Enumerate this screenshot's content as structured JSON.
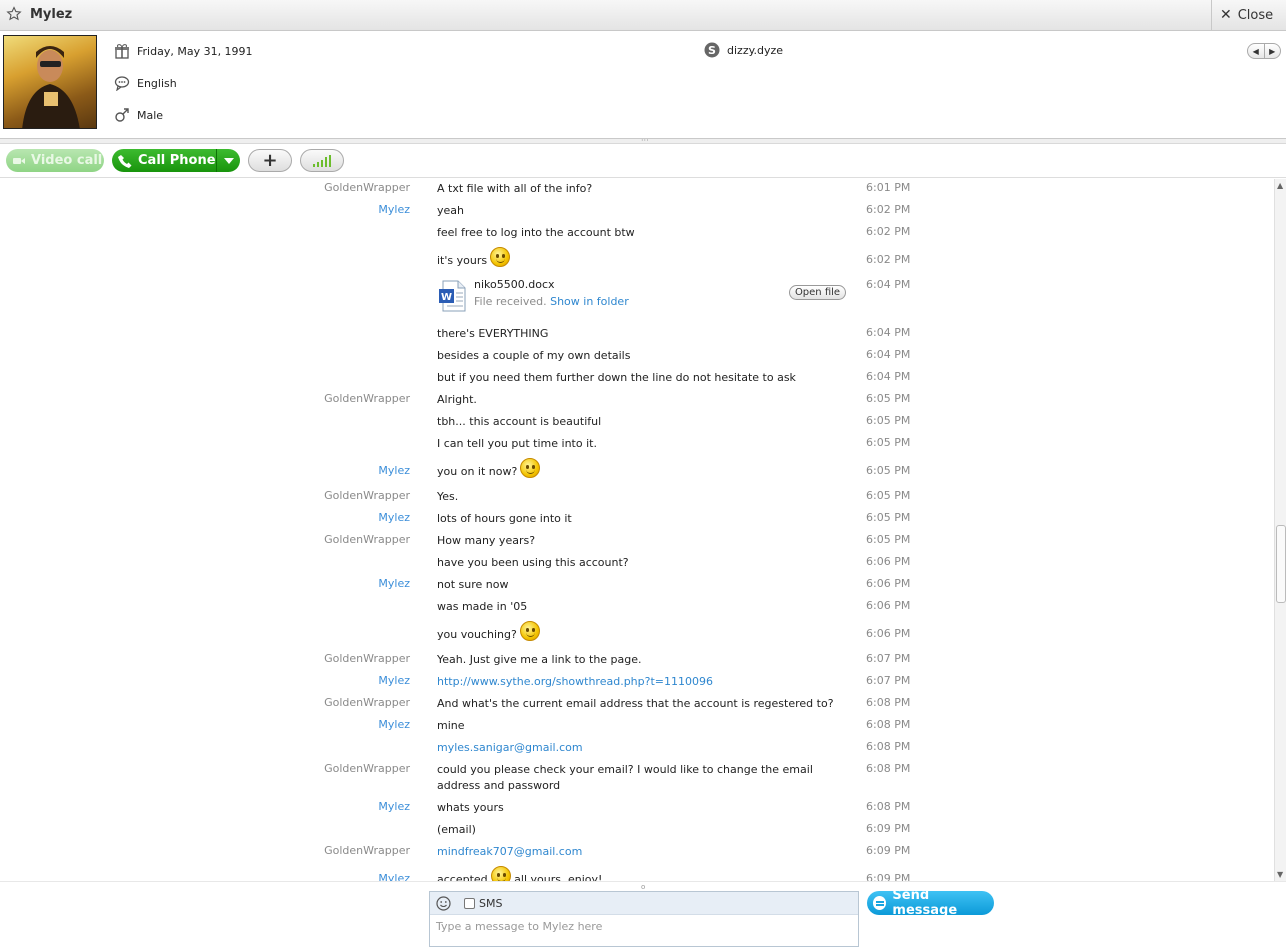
{
  "window": {
    "title": "Mylez",
    "close_label": "Close"
  },
  "profile": {
    "birthday": "Friday, May 31, 1991",
    "language": "English",
    "gender": "Male",
    "skype_name": "dizzy.dyze"
  },
  "toolbar": {
    "video_call": "Video call",
    "call_phone": "Call Phone",
    "add": "+"
  },
  "messages": [
    {
      "sender": "GoldenWrapper",
      "me": false,
      "text": "A txt file with all of the info?",
      "time": "6:01 PM"
    },
    {
      "sender": "Mylez",
      "me": true,
      "text": "yeah",
      "time": "6:02 PM"
    },
    {
      "sender": "",
      "me": true,
      "text": "feel free to log into the account btw",
      "time": "6:02 PM"
    },
    {
      "sender": "",
      "me": true,
      "text": "it's yours",
      "smiley": true,
      "time": "6:02 PM"
    },
    {
      "type": "file",
      "filename": "niko5500.docx",
      "status": "File received.",
      "show_link": "Show in folder",
      "open_label": "Open file",
      "time": "6:04 PM"
    },
    {
      "sender": "",
      "me": true,
      "text": "there's EVERYTHING",
      "time": "6:04 PM"
    },
    {
      "sender": "",
      "me": true,
      "text": "besides a couple of my own details",
      "time": "6:04 PM"
    },
    {
      "sender": "",
      "me": true,
      "text": "but if you need them further down the line do not hesitate to ask",
      "time": "6:04 PM"
    },
    {
      "sender": "GoldenWrapper",
      "me": false,
      "text": "Alright.",
      "time": "6:05 PM"
    },
    {
      "sender": "",
      "me": false,
      "text": "tbh... this account is beautiful",
      "time": "6:05 PM"
    },
    {
      "sender": "",
      "me": false,
      "text": "I can tell you put time into it.",
      "time": "6:05 PM"
    },
    {
      "sender": "Mylez",
      "me": true,
      "text": "you on it now?",
      "smiley": true,
      "time": "6:05 PM"
    },
    {
      "sender": "GoldenWrapper",
      "me": false,
      "text": "Yes.",
      "time": "6:05 PM"
    },
    {
      "sender": "Mylez",
      "me": true,
      "text": "lots of hours gone into it",
      "time": "6:05 PM"
    },
    {
      "sender": "GoldenWrapper",
      "me": false,
      "text": "How many years?",
      "time": "6:05 PM"
    },
    {
      "sender": "",
      "me": false,
      "text": "have you been using this account?",
      "time": "6:06 PM"
    },
    {
      "sender": "Mylez",
      "me": true,
      "text": "not sure now",
      "time": "6:06 PM"
    },
    {
      "sender": "",
      "me": true,
      "text": "was made in '05",
      "time": "6:06 PM"
    },
    {
      "sender": "",
      "me": true,
      "text": "you vouching?",
      "smiley": true,
      "time": "6:06 PM"
    },
    {
      "sender": "GoldenWrapper",
      "me": false,
      "text": "Yeah. Just give me a link to the page.",
      "time": "6:07 PM"
    },
    {
      "sender": "Mylez",
      "me": true,
      "text": "http://www.sythe.org/showthread.php?t=1110096",
      "link": true,
      "time": "6:07 PM"
    },
    {
      "sender": "GoldenWrapper",
      "me": false,
      "text": "And what's the current email address that the account is regestered to?",
      "time": "6:08 PM"
    },
    {
      "sender": "Mylez",
      "me": true,
      "text": "mine",
      "time": "6:08 PM"
    },
    {
      "sender": "",
      "me": true,
      "text": "myles.sanigar@gmail.com",
      "link": true,
      "time": "6:08 PM"
    },
    {
      "sender": "GoldenWrapper",
      "me": false,
      "text": "could you please check your email? I would like to change the email address and password",
      "time": "6:08 PM"
    },
    {
      "sender": "Mylez",
      "me": true,
      "text": "whats yours",
      "time": "6:08 PM"
    },
    {
      "sender": "",
      "me": true,
      "text": "(email)",
      "time": "6:09 PM"
    },
    {
      "sender": "GoldenWrapper",
      "me": false,
      "text": "mindfreak707@gmail.com",
      "link": true,
      "time": "6:09 PM"
    },
    {
      "sender": "Mylez",
      "me": true,
      "text": "accepted",
      "smiley": true,
      "after": "all yours, enjoy!",
      "time": "6:09 PM"
    }
  ],
  "compose": {
    "sms_label": "SMS",
    "placeholder": "Type a message to Mylez here",
    "send_label": "Send message"
  },
  "colors": {
    "sender_me": "#3b8ed9",
    "sender_other": "#8a8a8a",
    "call_green": "#18940c",
    "send_blue": "#0c9ad8"
  }
}
